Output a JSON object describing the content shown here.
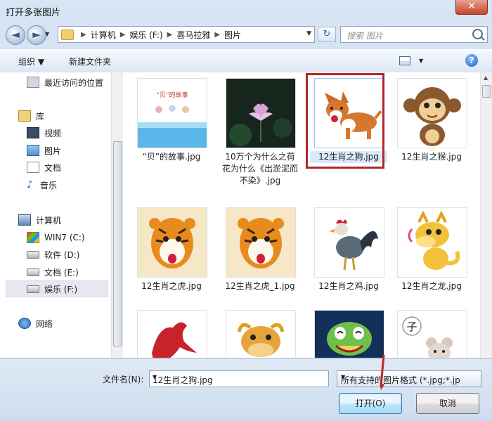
{
  "window": {
    "title": "打开多张图片",
    "close_label": "✕"
  },
  "nav": {
    "back_glyph": "◄",
    "forward_glyph": "►",
    "refresh_glyph": "↻"
  },
  "address": {
    "crumbs": [
      "计算机",
      "娱乐 (F:)",
      "喜马拉雅",
      "图片"
    ]
  },
  "search": {
    "placeholder": "搜索 图片"
  },
  "toolbar": {
    "organize": "组织 ▼",
    "new_folder": "新建文件夹"
  },
  "sidebar": {
    "recent": "最近访问的位置",
    "libraries": "库",
    "videos": "视频",
    "pictures": "图片",
    "documents": "文档",
    "music": "音乐",
    "computer": "计算机",
    "drive_c": "WIN7 (C:)",
    "drive_d": "软件 (D:)",
    "drive_e": "文档 (E:)",
    "drive_f": "娱乐 (F:)",
    "network": "网络"
  },
  "files": [
    {
      "name": "“贝”的故事.jpg",
      "thumb": "shell-story"
    },
    {
      "name": "10万个为什么之荷花为什么《出淤泥而不染》.jpg",
      "thumb": "lotus"
    },
    {
      "name": "12生肖之狗.jpg",
      "thumb": "dog",
      "selected": true
    },
    {
      "name": "12生肖之猴.jpg",
      "thumb": "monkey"
    },
    {
      "name": "12生肖之虎.jpg",
      "thumb": "tiger"
    },
    {
      "name": "12生肖之虎_1.jpg",
      "thumb": "tiger"
    },
    {
      "name": "12生肖之鸡.jpg",
      "thumb": "rooster"
    },
    {
      "name": "12生肖之龙.jpg",
      "thumb": "dragon"
    },
    {
      "name": "",
      "thumb": "horse"
    },
    {
      "name": "",
      "thumb": "ox"
    },
    {
      "name": "",
      "thumb": "snake"
    },
    {
      "name": "",
      "thumb": "rat"
    }
  ],
  "thumbs": {
    "shell_title": "“贝”的故事",
    "rat_char": "子"
  },
  "footer": {
    "filename_label": "文件名(N):",
    "filename_value": "12生肖之狗.jpg",
    "filter_value": "所有支持的图片格式 (*.jpg;*.jp",
    "open_button": "打开(O)",
    "cancel_button": "取消"
  },
  "colors": {
    "selection_outline": "#b3262a",
    "annotation_arrow": "#c0262a"
  }
}
